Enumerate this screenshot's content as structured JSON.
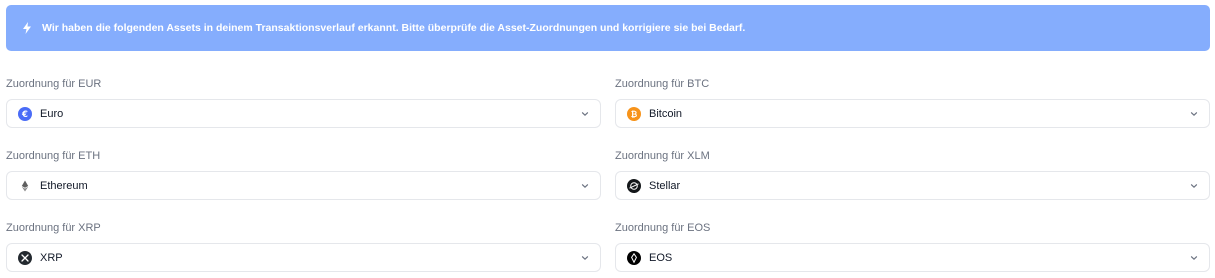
{
  "banner": {
    "icon": "lightning-icon",
    "text": "Wir haben die folgenden Assets in deinem Transaktionsverlauf erkannt. Bitte überprüfe die Asset-Zuordnungen und korrigiere sie bei Bedarf."
  },
  "mappings": [
    {
      "label": "Zuordnung für EUR",
      "value": "Euro",
      "icon": "euro-icon",
      "color": "#4a6cf7"
    },
    {
      "label": "Zuordnung für BTC",
      "value": "Bitcoin",
      "icon": "bitcoin-icon",
      "color": "#f7931a"
    },
    {
      "label": "Zuordnung für ETH",
      "value": "Ethereum",
      "icon": "ethereum-icon",
      "color": "#ecf0f1"
    },
    {
      "label": "Zuordnung für XLM",
      "value": "Stellar",
      "icon": "stellar-icon",
      "color": "#14171a"
    },
    {
      "label": "Zuordnung für XRP",
      "value": "XRP",
      "icon": "xrp-icon",
      "color": "#23292f"
    },
    {
      "label": "Zuordnung für EOS",
      "value": "EOS",
      "icon": "eos-icon",
      "color": "#000000"
    }
  ],
  "colors": {
    "banner_bg": "#85adfd",
    "label": "#6b7280",
    "border": "#e5e7eb"
  }
}
